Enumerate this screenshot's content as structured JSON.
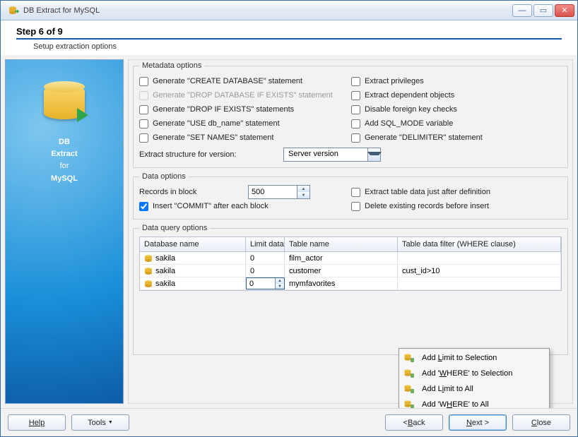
{
  "window": {
    "title": "DB Extract for MySQL"
  },
  "header": {
    "step": "Step 6 of 9",
    "subtitle": "Setup extraction options"
  },
  "sidebar": {
    "line1": "DB",
    "line2": "Extract",
    "line3": "for",
    "line4": "MySQL"
  },
  "metadata_options": {
    "legend": "Metadata options",
    "left": [
      {
        "label": "Generate \"CREATE DATABASE\" statement",
        "checked": false,
        "disabled": false
      },
      {
        "label": "Generate \"DROP DATABASE IF EXISTS\" statement",
        "checked": false,
        "disabled": true
      },
      {
        "label": "Generate \"DROP IF EXISTS\" statements",
        "checked": false,
        "disabled": false
      },
      {
        "label": "Generate \"USE db_name\" statement",
        "checked": false,
        "disabled": false
      },
      {
        "label": "Generate \"SET NAMES\" statement",
        "checked": false,
        "disabled": false
      }
    ],
    "right": [
      {
        "label": "Extract privileges",
        "checked": false
      },
      {
        "label": "Extract dependent objects",
        "checked": false
      },
      {
        "label": "Disable foreign key checks",
        "checked": false
      },
      {
        "label": "Add SQL_MODE variable",
        "checked": false
      },
      {
        "label": "Generate \"DELIMITER\" statement",
        "checked": false
      }
    ],
    "version_label": "Extract structure for version:",
    "version_value": "Server version"
  },
  "data_options": {
    "legend": "Data options",
    "records_label": "Records in block",
    "records_value": "500",
    "commit_label": "Insert \"COMMIT\" after each block",
    "commit_checked": true,
    "extract_after_label": "Extract table data just after definition",
    "extract_after_checked": false,
    "delete_before_label": "Delete existing records before insert",
    "delete_before_checked": false
  },
  "query_options": {
    "legend": "Data query options",
    "headers": {
      "db": "Database name",
      "limit": "Limit data",
      "table": "Table name",
      "where": "Table data filter (WHERE clause)"
    },
    "rows": [
      {
        "db": "sakila",
        "limit": "0",
        "table": "film_actor",
        "where": ""
      },
      {
        "db": "sakila",
        "limit": "0",
        "table": "customer",
        "where": "cust_id>10"
      },
      {
        "db": "sakila",
        "limit": "0",
        "table": "mymfavorites",
        "where": ""
      }
    ]
  },
  "context_menu": {
    "items": [
      {
        "pre": "Add ",
        "u": "L",
        "post": "imit to Selection"
      },
      {
        "pre": "Add '",
        "u": "W",
        "post": "HERE' to Selection"
      },
      {
        "pre": "Add L",
        "u": "i",
        "post": "mit to All"
      },
      {
        "pre": "Add 'W",
        "u": "H",
        "post": "ERE' to All"
      }
    ]
  },
  "footer": {
    "help": "Help",
    "tools": "Tools",
    "back_pre": "< ",
    "back_u": "B",
    "back_post": "ack",
    "next_pre": "",
    "next_u": "N",
    "next_post": "ext >",
    "close_pre": "",
    "close_u": "C",
    "close_post": "lose"
  }
}
